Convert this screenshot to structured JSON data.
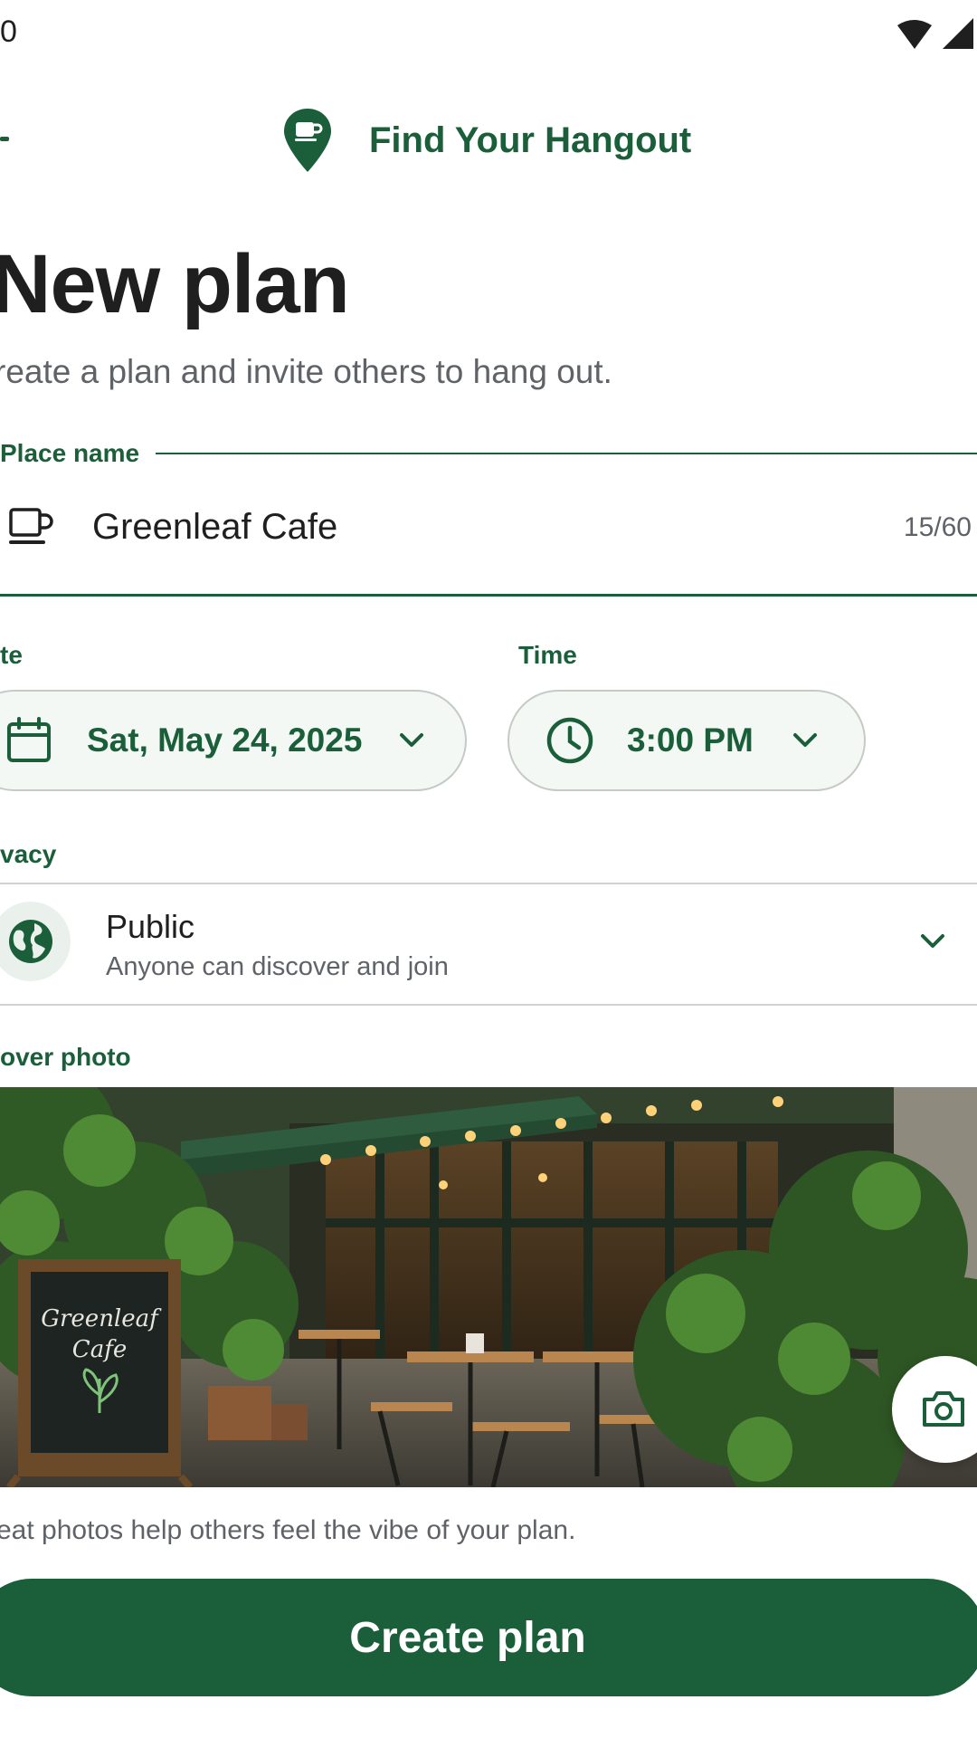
{
  "status_bar": {
    "time": "0"
  },
  "header": {
    "app_title": "Find Your Hangout"
  },
  "page": {
    "title": "New plan",
    "subtitle": "reate a plan and invite others to hang out."
  },
  "place": {
    "label": "Place name",
    "value": "Greenleaf Cafe",
    "counter": "15/60",
    "icon": "coffee-cup-icon"
  },
  "date": {
    "label": "te",
    "value": "Sat, May 24, 2025",
    "icon": "calendar-icon"
  },
  "time": {
    "label": "Time",
    "value": "3:00 PM",
    "icon": "clock-icon"
  },
  "privacy": {
    "label": "vacy",
    "title": "Public",
    "description": "Anyone can discover and join",
    "icon": "globe-icon"
  },
  "cover": {
    "label": "over photo",
    "sign_line1": "Greenleaf",
    "sign_line2": "Cafe",
    "hint": "eat photos help others feel the vibe of your plan."
  },
  "cta": {
    "label": "Create plan"
  },
  "colors": {
    "accent": "#1b5e3a",
    "pill_bg": "#f4f8f5",
    "muted_text": "#5f6368"
  }
}
